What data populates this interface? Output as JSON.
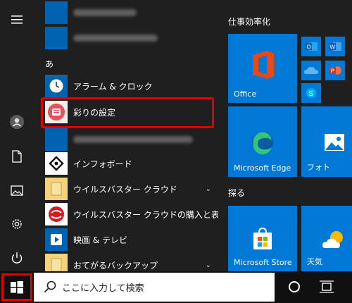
{
  "applist": {
    "section_a": "あ",
    "items": [
      {
        "label": "アラーム & クロック"
      },
      {
        "label": "彩りの設定"
      },
      {
        "label": "インフォボード"
      },
      {
        "label": "ウイルスバスター クラウド",
        "chevron": "⌄"
      },
      {
        "label": "ウイルスバスター クラウドの購入と表示"
      },
      {
        "label": "映画 & テレビ"
      },
      {
        "label": "おてがるバックアップ",
        "chevron": "⌄"
      }
    ]
  },
  "tiles": {
    "group1_title": "仕事効率化",
    "group2_title": "探る",
    "office_label": "Office",
    "edge_label": "Microsoft Edge",
    "photos_label": "フォト",
    "store_label": "Microsoft Store",
    "weather_label": "天気"
  },
  "taskbar": {
    "search_placeholder": "ここに入力して検索"
  },
  "colors": {
    "tile_blue": "#0078d7",
    "highlight_red": "#e00000",
    "background": "#1f1f1f"
  }
}
